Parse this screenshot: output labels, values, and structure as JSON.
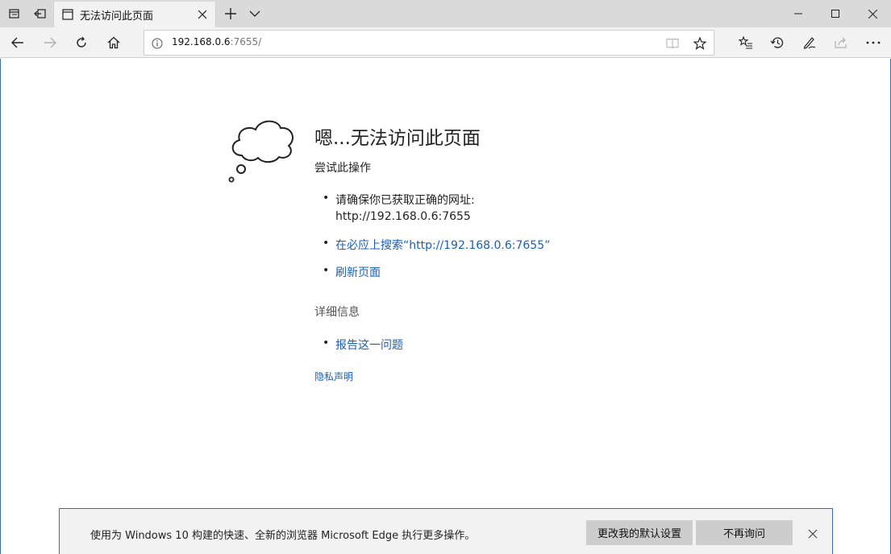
{
  "tab": {
    "title": "无法访问此页面"
  },
  "address": {
    "host": "192.168.0.6",
    "rest": ":7655/"
  },
  "error": {
    "heading": "嗯...无法访问此页面",
    "subheading": "尝试此操作",
    "check_line1": "请确保你已获取正确的网址:",
    "check_line2": "http://192.168.0.6:7655",
    "search_link": "在必应上搜索“http://192.168.0.6:7655”",
    "refresh_link": "刷新页面",
    "details_label": "详细信息",
    "report_link": "报告这一问题",
    "privacy_link": "隐私声明"
  },
  "notification": {
    "text": "使用为 Windows 10 构建的快速、全新的浏览器 Microsoft Edge 执行更多操作。",
    "change_default_label": "更改我的默认设置",
    "dont_ask_label": "不再询问"
  },
  "colors": {
    "link": "#1a5fb4",
    "accent_border": "#2f6db5"
  }
}
